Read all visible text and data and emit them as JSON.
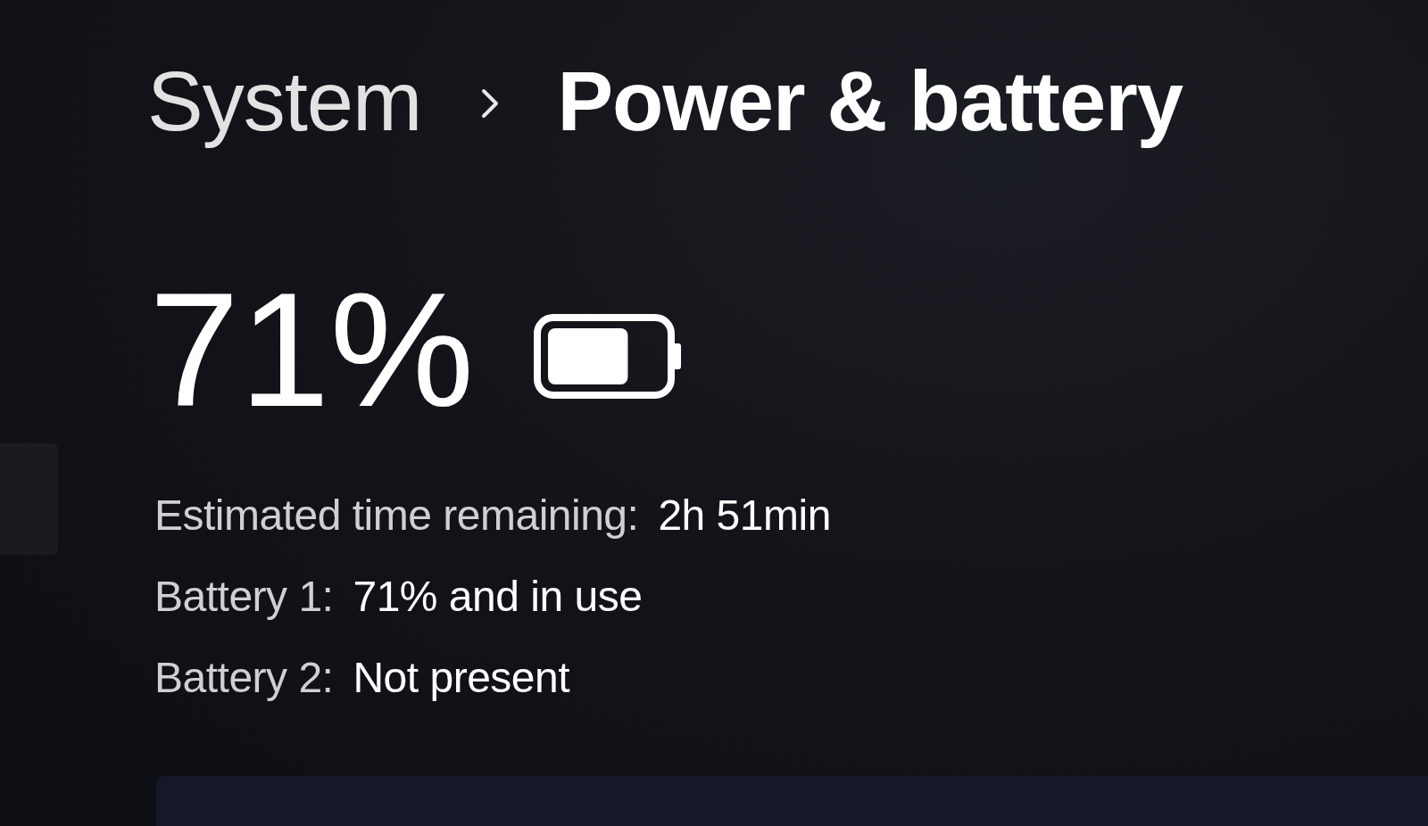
{
  "breadcrumb": [
    {
      "label": "System",
      "selected": false
    },
    {
      "label": "Power & battery",
      "selected": true
    }
  ],
  "battery": {
    "percent": "71%",
    "level": 0.71
  },
  "details": [
    {
      "label": "Estimated time remaining:",
      "value": "2h 51min"
    },
    {
      "label": "Battery 1:",
      "value": "71% and in use"
    },
    {
      "label": "Battery 2:",
      "value": "Not present"
    }
  ]
}
